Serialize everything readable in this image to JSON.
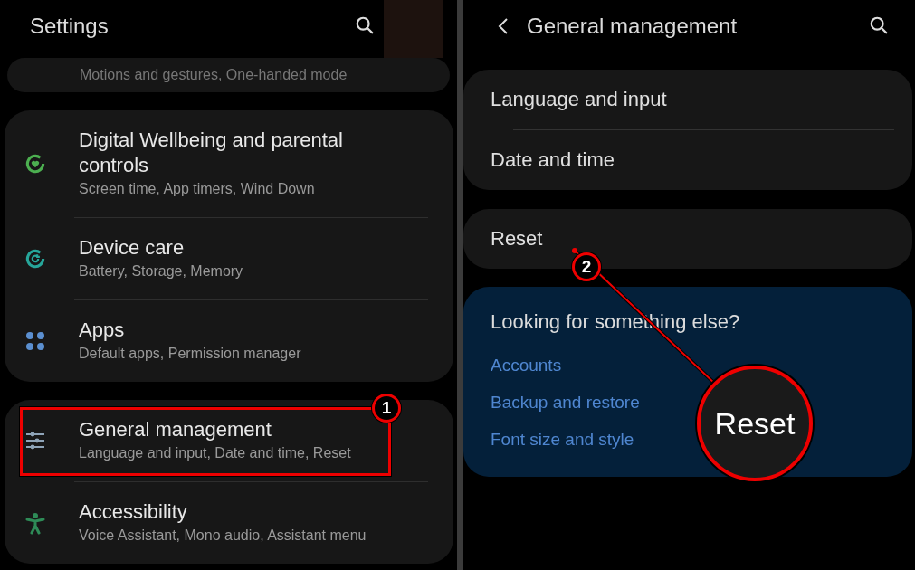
{
  "left_screen": {
    "title": "Settings",
    "cut_item": {
      "subtitle": "Motions and gestures, One-handed mode"
    },
    "groups": [
      {
        "items": [
          {
            "kind": "wellbeing",
            "title": "Digital Wellbeing and parental controls",
            "subtitle": "Screen time, App timers, Wind Down",
            "highlighted": false
          },
          {
            "kind": "care",
            "title": "Device care",
            "subtitle": "Battery, Storage, Memory",
            "highlighted": false
          },
          {
            "kind": "apps",
            "title": "Apps",
            "subtitle": "Default apps, Permission manager",
            "highlighted": false
          }
        ]
      },
      {
        "items": [
          {
            "kind": "general",
            "title": "General management",
            "subtitle": "Language and input, Date and time, Reset",
            "highlighted": true,
            "callout": "1"
          },
          {
            "kind": "accessibility",
            "title": "Accessibility",
            "subtitle": "Voice Assistant, Mono audio, Assistant menu",
            "highlighted": false
          }
        ]
      }
    ]
  },
  "right_screen": {
    "title": "General management",
    "groups": [
      {
        "items": [
          {
            "title": "Language and input"
          },
          {
            "title": "Date and time"
          }
        ]
      },
      {
        "items": [
          {
            "title": "Reset",
            "callout": "2"
          }
        ]
      }
    ],
    "suggestions": {
      "title": "Looking for something else?",
      "links": [
        "Accounts",
        "Backup and restore",
        "Font size and style"
      ]
    }
  },
  "magnifier": {
    "text": "Reset"
  }
}
